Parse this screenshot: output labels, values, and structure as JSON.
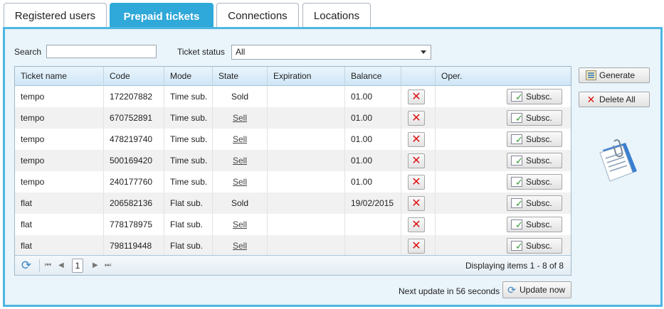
{
  "tabs": [
    {
      "label": "Registered users",
      "active": false
    },
    {
      "label": "Prepaid tickets",
      "active": true
    },
    {
      "label": "Connections",
      "active": false
    },
    {
      "label": "Locations",
      "active": false
    }
  ],
  "filters": {
    "search_label": "Search",
    "search_value": "",
    "status_label": "Ticket status",
    "status_value": "All"
  },
  "grid": {
    "columns": [
      "Ticket name",
      "Code",
      "Mode",
      "State",
      "Expiration",
      "Balance",
      "",
      "Oper."
    ],
    "rows": [
      {
        "name": "tempo",
        "code": "172207882",
        "mode": "Time sub.",
        "state": "Sold",
        "state_link": false,
        "expiration": "",
        "balance": "01.00",
        "subscribe_label": "Subsc."
      },
      {
        "name": "tempo",
        "code": "670752891",
        "mode": "Time sub.",
        "state": "Sell",
        "state_link": true,
        "expiration": "",
        "balance": "01.00",
        "subscribe_label": "Subsc."
      },
      {
        "name": "tempo",
        "code": "478219740",
        "mode": "Time sub.",
        "state": "Sell",
        "state_link": true,
        "expiration": "",
        "balance": "01.00",
        "subscribe_label": "Subsc."
      },
      {
        "name": "tempo",
        "code": "500169420",
        "mode": "Time sub.",
        "state": "Sell",
        "state_link": true,
        "expiration": "",
        "balance": "01.00",
        "subscribe_label": "Subsc."
      },
      {
        "name": "tempo",
        "code": "240177760",
        "mode": "Time sub.",
        "state": "Sell",
        "state_link": true,
        "expiration": "",
        "balance": "01.00",
        "subscribe_label": "Subsc."
      },
      {
        "name": "flat",
        "code": "206582136",
        "mode": "Flat sub.",
        "state": "Sold",
        "state_link": false,
        "expiration": "",
        "balance": "19/02/2015",
        "subscribe_label": "Subsc."
      },
      {
        "name": "flat",
        "code": "778178975",
        "mode": "Flat sub.",
        "state": "Sell",
        "state_link": true,
        "expiration": "",
        "balance": "",
        "subscribe_label": "Subsc."
      },
      {
        "name": "flat",
        "code": "798119448",
        "mode": "Flat sub.",
        "state": "Sell",
        "state_link": true,
        "expiration": "",
        "balance": "",
        "subscribe_label": "Subsc."
      }
    ],
    "pager": {
      "current_page": "1",
      "info": "Displaying items 1 - 8 of 8"
    }
  },
  "actions": {
    "generate_label": "Generate",
    "delete_all_label": "Delete All"
  },
  "footer": {
    "next_update_text": "Next update in 56 seconds",
    "update_now_label": "Update now"
  },
  "icons": {
    "delete": "delete-x-icon",
    "subscribe": "subscribe-check-icon",
    "refresh": "refresh-icon",
    "generate": "generate-ticket-icon",
    "document": "document-clip-icon"
  },
  "colors": {
    "accent": "#2fa8da",
    "panel_border": "#4db6e2",
    "panel_bg": "#e9f4fb",
    "delete_red": "#dd1111"
  }
}
